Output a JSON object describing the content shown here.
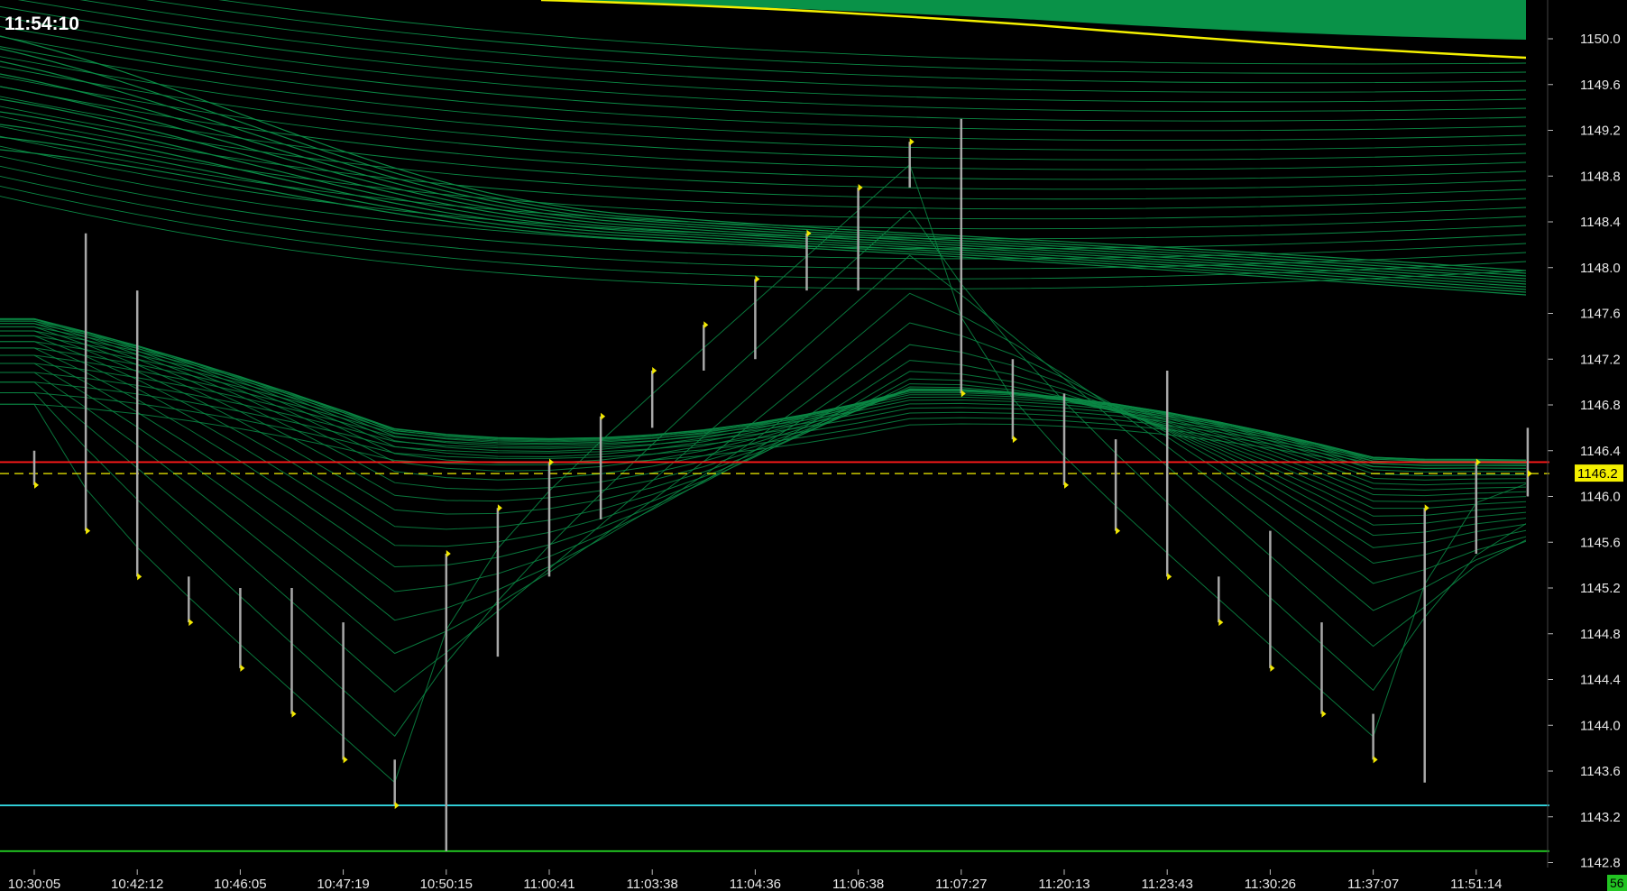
{
  "clock": "11:54:10",
  "price_label": "1146.2",
  "corner_count": "56",
  "colors": {
    "background": "#000000",
    "ribbon": "#0b8a45",
    "ribbon_fill": "#0a9a4c",
    "bar": "#a8a8a8",
    "close_tick": "#f2e800",
    "yellow_ma": "#f4f000",
    "resistance": "#ff1a1a",
    "current": "#f4f000",
    "cyan_line": "#33d6e0",
    "green_line": "#22cc22",
    "axis_text": "#e6e6e6",
    "count_box": "#22c422"
  },
  "chart_data": {
    "type": "bar",
    "ylim": [
      1142.8,
      1150.4
    ],
    "y_ticks": [
      "1150.0",
      "1149.6",
      "1149.2",
      "1148.8",
      "1148.4",
      "1148.0",
      "1147.6",
      "1147.2",
      "1146.8",
      "1146.4",
      "1146.0",
      "1145.6",
      "1145.2",
      "1144.8",
      "1144.4",
      "1144.0",
      "1143.6",
      "1143.2",
      "1142.8"
    ],
    "x_ticks": [
      "10:30:05",
      "10:42:12",
      "10:46:05",
      "10:47:19",
      "10:50:15",
      "11:00:41",
      "11:03:38",
      "11:04:36",
      "11:06:38",
      "11:07:27",
      "11:20:13",
      "11:23:43",
      "11:30:26",
      "11:37:07",
      "11:51:14"
    ],
    "bars": [
      {
        "high": 1146.4,
        "low": 1146.1,
        "close": 1146.1
      },
      {
        "high": 1148.3,
        "low": 1145.7,
        "close": 1145.7
      },
      {
        "high": 1147.8,
        "low": 1145.3,
        "close": 1145.3
      },
      {
        "high": 1145.3,
        "low": 1144.9,
        "close": 1144.9
      },
      {
        "high": 1145.2,
        "low": 1144.5,
        "close": 1144.5
      },
      {
        "high": 1145.2,
        "low": 1144.1,
        "close": 1144.1
      },
      {
        "high": 1144.9,
        "low": 1143.7,
        "close": 1143.7
      },
      {
        "high": 1143.7,
        "low": 1143.3,
        "close": 1143.3
      },
      {
        "high": 1145.5,
        "low": 1142.9,
        "close": 1145.5
      },
      {
        "high": 1145.9,
        "low": 1144.6,
        "close": 1145.9
      },
      {
        "high": 1146.3,
        "low": 1145.3,
        "close": 1146.3
      },
      {
        "high": 1146.7,
        "low": 1145.8,
        "close": 1146.7
      },
      {
        "high": 1147.1,
        "low": 1146.6,
        "close": 1147.1
      },
      {
        "high": 1147.5,
        "low": 1147.1,
        "close": 1147.5
      },
      {
        "high": 1147.9,
        "low": 1147.2,
        "close": 1147.9
      },
      {
        "high": 1148.3,
        "low": 1147.8,
        "close": 1148.3
      },
      {
        "high": 1148.7,
        "low": 1147.8,
        "close": 1148.7
      },
      {
        "high": 1149.1,
        "low": 1148.7,
        "close": 1149.1
      },
      {
        "high": 1149.3,
        "low": 1146.9,
        "close": 1146.9
      },
      {
        "high": 1147.2,
        "low": 1146.5,
        "close": 1146.5
      },
      {
        "high": 1146.9,
        "low": 1146.1,
        "close": 1146.1
      },
      {
        "high": 1146.5,
        "low": 1145.7,
        "close": 1145.7
      },
      {
        "high": 1147.1,
        "low": 1145.3,
        "close": 1145.3
      },
      {
        "high": 1145.3,
        "low": 1144.9,
        "close": 1144.9
      },
      {
        "high": 1145.7,
        "low": 1144.5,
        "close": 1144.5
      },
      {
        "high": 1144.9,
        "low": 1144.1,
        "close": 1144.1
      },
      {
        "high": 1144.1,
        "low": 1143.7,
        "close": 1143.7
      },
      {
        "high": 1145.9,
        "low": 1143.5,
        "close": 1145.9
      },
      {
        "high": 1146.3,
        "low": 1145.5,
        "close": 1146.3
      },
      {
        "high": 1146.6,
        "low": 1146.0,
        "close": 1146.2
      }
    ],
    "levels": [
      {
        "value": 1146.3,
        "color": "#ff1a1a",
        "style": "solid"
      },
      {
        "value": 1146.2,
        "color": "#f4f000",
        "style": "dashed"
      },
      {
        "value": 1143.3,
        "color": "#33d6e0",
        "style": "solid"
      },
      {
        "value": 1142.9,
        "color": "#22cc22",
        "style": "solid"
      }
    ],
    "moving_average_end": 1149.8
  }
}
